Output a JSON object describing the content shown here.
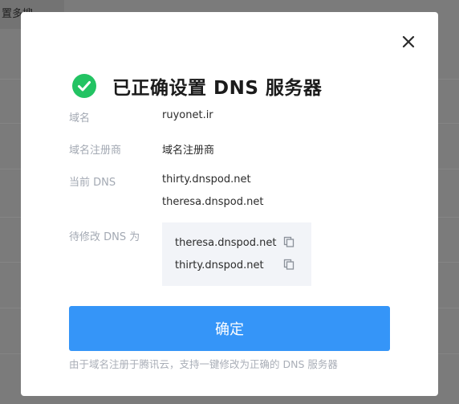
{
  "background": {
    "tab_fragment": "置多搜"
  },
  "dialog": {
    "title": "已正确设置 DNS 服务器",
    "status_icon": "check-circle-icon",
    "status_color": "#23c363",
    "close_icon": "close-icon",
    "fields": {
      "domain_label": "域名",
      "domain_value": "ruyonet.ir",
      "registrar_label": "域名注册商",
      "registrar_value": "域名注册商",
      "current_dns_label": "当前 DNS",
      "current_dns": [
        "thirty.dnspod.net",
        "theresa.dnspod.net"
      ],
      "target_dns_label": "待修改 DNS 为",
      "target_dns": [
        "theresa.dnspod.net",
        "thirty.dnspod.net"
      ]
    },
    "copy_icon": "copy-icon",
    "confirm_label": "确定",
    "accent_color": "#3595f8",
    "footer_note": "由于域名注册于腾讯云，支持一键修改为正确的 DNS 服务器"
  }
}
